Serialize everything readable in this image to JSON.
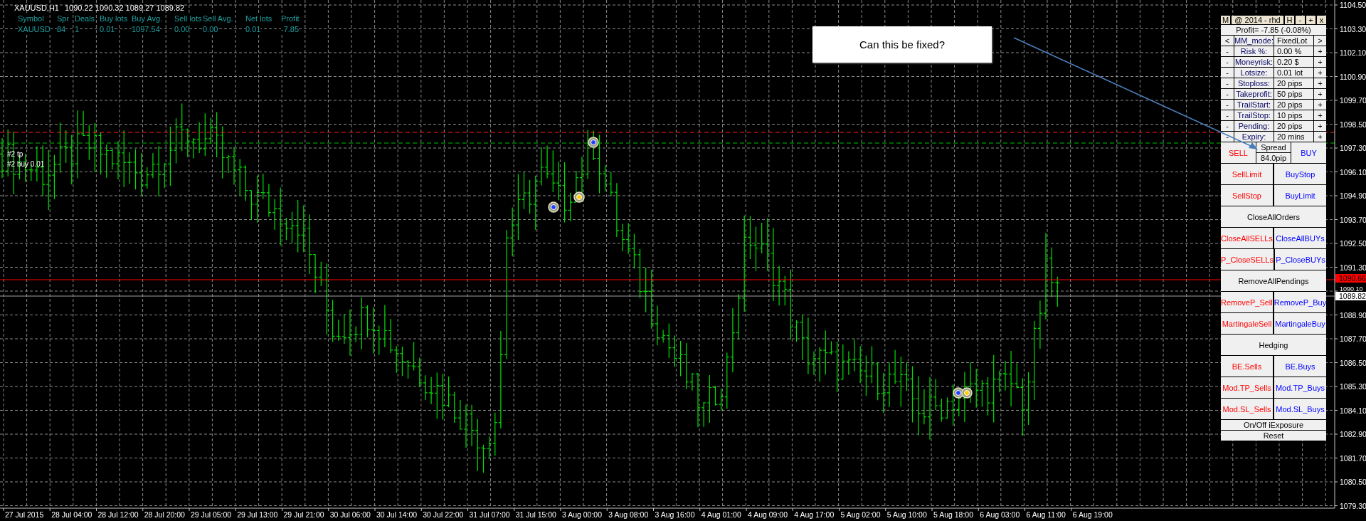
{
  "chart_header": {
    "symbol": "XAUUSD,H1",
    "prices": "1090.22 1090.32 1089.27 1089.82"
  },
  "positions": {
    "columns": [
      "Symbol",
      "Spr",
      "Deals",
      "Buy lots",
      "Buy Avg.",
      "Sell lots",
      "Sell Avg.",
      "Net lots",
      "Profit"
    ],
    "rows": [
      [
        "XAUUSD",
        "84",
        "1",
        "0.01",
        "1097.54",
        "0.00",
        "0.00",
        "0.01",
        "-7.85"
      ]
    ]
  },
  "order_lines": [
    {
      "label": "#2 tp",
      "kind": "tp"
    },
    {
      "label": "#2 buy 0.01",
      "kind": "entry"
    }
  ],
  "callout": {
    "text": "Can this be fixed?"
  },
  "panel": {
    "title_left": [
      "M"
    ],
    "title": "@ 2014 - rhd",
    "title_right": [
      "H",
      "-",
      "+",
      "x"
    ],
    "profit": "Profit= -7.85 (-0.08%)",
    "settings": [
      {
        "dec": "<",
        "label": "MM_mode:",
        "value": "FixedLot",
        "inc": ">"
      },
      {
        "dec": "-",
        "label": "Risk %:",
        "value": "0.00 %",
        "inc": "+"
      },
      {
        "dec": "-",
        "label": "Moneyrisk:",
        "value": "0.20 $",
        "inc": "+"
      },
      {
        "dec": "-",
        "label": "Lotsize:",
        "value": "0.01 lot",
        "inc": "+"
      },
      {
        "dec": "-",
        "label": "Stoploss:",
        "value": "20 pips",
        "inc": "+"
      },
      {
        "dec": "-",
        "label": "Takeprofit:",
        "value": "50 pips",
        "inc": "+"
      },
      {
        "dec": "-",
        "label": "TrailStart:",
        "value": "20 pips",
        "inc": "+"
      },
      {
        "dec": "-",
        "label": "TrailStop:",
        "value": "10 pips",
        "inc": "+"
      },
      {
        "dec": "-",
        "label": "Pending:",
        "value": "20 pips",
        "inc": "+"
      },
      {
        "dec": "-",
        "label": "Expiry:",
        "value": "20 mins",
        "inc": "+"
      }
    ],
    "trade": {
      "sell": {
        "label": "SELL",
        "color": "#ff0000"
      },
      "spread_label": "Spread",
      "spread_value": "84.0pip",
      "buy": {
        "label": "BUY",
        "color": "#0000ff"
      }
    },
    "button_rows": [
      {
        "kind": "large",
        "buttons": [
          {
            "label": "SellLimit",
            "color": "#ff0000"
          },
          {
            "label": "BuyStop",
            "color": "#0000ff"
          }
        ]
      },
      {
        "kind": "large",
        "buttons": [
          {
            "label": "SellStop",
            "color": "#ff0000"
          },
          {
            "label": "BuyLimit",
            "color": "#0000ff"
          }
        ]
      },
      {
        "kind": "large",
        "buttons": [
          {
            "label": "CloseAllOrders",
            "color": "#000000"
          }
        ]
      },
      {
        "kind": "large",
        "buttons": [
          {
            "label": "CloseAllSELLs",
            "color": "#ff0000"
          },
          {
            "label": "CloseAllBUYs",
            "color": "#0000ff"
          }
        ]
      },
      {
        "kind": "large",
        "buttons": [
          {
            "label": "P_CloseSELLs",
            "color": "#ff0000"
          },
          {
            "label": "P_CloseBUYs",
            "color": "#0000ff"
          }
        ]
      },
      {
        "kind": "large",
        "buttons": [
          {
            "label": "RemoveAllPendings",
            "color": "#000000"
          }
        ]
      },
      {
        "kind": "large",
        "buttons": [
          {
            "label": "RemoveP_Sell",
            "color": "#ff0000"
          },
          {
            "label": "RemoveP_Buy",
            "color": "#0000ff"
          }
        ]
      },
      {
        "kind": "large",
        "buttons": [
          {
            "label": "MartingaleSell",
            "color": "#ff0000"
          },
          {
            "label": "MartingaleBuy",
            "color": "#0000ff"
          }
        ]
      },
      {
        "kind": "large",
        "buttons": [
          {
            "label": "Hedging",
            "color": "#000000"
          }
        ]
      },
      {
        "kind": "large",
        "buttons": [
          {
            "label": "BE.Sells",
            "color": "#ff0000"
          },
          {
            "label": "BE.Buys",
            "color": "#0000ff"
          }
        ]
      },
      {
        "kind": "large",
        "buttons": [
          {
            "label": "Mod.TP_Sells",
            "color": "#ff0000"
          },
          {
            "label": "Mod.TP_Buys",
            "color": "#0000ff"
          }
        ]
      },
      {
        "kind": "large",
        "buttons": [
          {
            "label": "Mod.SL_Sells",
            "color": "#ff0000"
          },
          {
            "label": "Mod.SL_Buys",
            "color": "#0000ff"
          }
        ]
      },
      {
        "kind": "small",
        "buttons": [
          {
            "label": "On/Off iExposure",
            "color": "#000000"
          }
        ]
      },
      {
        "kind": "small",
        "buttons": [
          {
            "label": "Reset",
            "color": "#000000"
          }
        ]
      }
    ]
  },
  "price_axis": [
    "1104.50",
    "1103.30",
    "1102.10",
    "1100.90",
    "1099.70",
    "1098.50",
    "1097.30",
    "1096.10",
    "1094.90",
    "1093.70",
    "1092.50",
    "1091.30",
    "1090.10",
    "1088.90",
    "1087.70",
    "1086.50",
    "1085.30",
    "1084.10",
    "1082.90",
    "1081.70",
    "1080.50",
    "1079.30"
  ],
  "price_tags": [
    {
      "text": "1090.66",
      "kind": "bid"
    },
    {
      "text": "1089.82",
      "kind": "last"
    }
  ],
  "time_axis": [
    "27 Jul 2015",
    "28 Jul 04:00",
    "28 Jul 12:00",
    "28 Jul 20:00",
    "29 Jul 05:00",
    "29 Jul 13:00",
    "29 Jul 21:00",
    "30 Jul 06:00",
    "30 Jul 14:00",
    "30 Jul 22:00",
    "31 Jul 07:00",
    "31 Jul 15:00",
    "3 Aug 00:00",
    "3 Aug 08:00",
    "3 Aug 16:00",
    "4 Aug 01:00",
    "4 Aug 09:00",
    "4 Aug 17:00",
    "5 Aug 02:00",
    "5 Aug 10:00",
    "5 Aug 18:00",
    "6 Aug 03:00",
    "6 Aug 11:00",
    "6 Aug 19:00"
  ]
}
